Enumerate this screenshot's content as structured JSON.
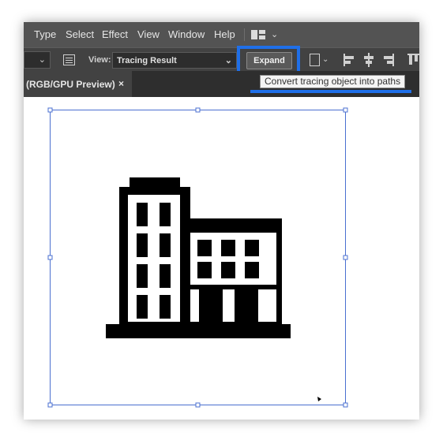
{
  "menubar": {
    "items": [
      "Type",
      "Select",
      "Effect",
      "View",
      "Window",
      "Help"
    ]
  },
  "control_bar": {
    "view_label": "View:",
    "view_value": "Tracing Result",
    "expand_label": "Expand"
  },
  "tab": {
    "label": "(RGB/GPU Preview)",
    "close": "×"
  },
  "tooltip": {
    "text": "Convert tracing object into paths"
  },
  "icons": {
    "workspace": "workspace-switcher-icon",
    "options": "tracing-options-icon",
    "document": "document-setup-icon",
    "align": [
      "align-left-icon",
      "align-horizontal-center-icon",
      "align-right-icon",
      "align-top-icon"
    ],
    "artwork": "office-building-icon"
  },
  "colors": {
    "highlight": "#1f6fe8",
    "selection": "#4a6fd0",
    "menubar_bg": "#535353",
    "control_bg": "#424242"
  }
}
